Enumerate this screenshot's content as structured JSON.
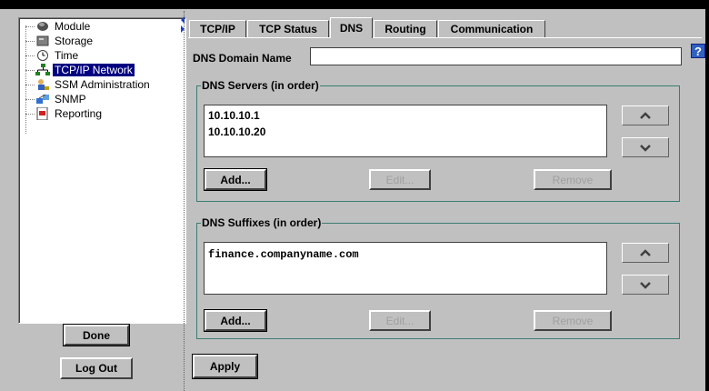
{
  "tree": {
    "items": [
      {
        "label": "Module",
        "icon": "module-icon"
      },
      {
        "label": "Storage",
        "icon": "storage-icon"
      },
      {
        "label": "Time",
        "icon": "clock-icon"
      },
      {
        "label": "TCP/IP Network",
        "icon": "network-icon",
        "selected": true
      },
      {
        "label": "SSM Administration",
        "icon": "admin-icon"
      },
      {
        "label": "SNMP",
        "icon": "snmp-icon"
      },
      {
        "label": "Reporting",
        "icon": "report-icon"
      }
    ]
  },
  "left_buttons": {
    "done": "Done",
    "logout": "Log Out"
  },
  "tabs": [
    {
      "label": "TCP/IP"
    },
    {
      "label": "TCP Status"
    },
    {
      "label": "DNS",
      "active": true
    },
    {
      "label": "Routing"
    },
    {
      "label": "Communication"
    }
  ],
  "help": {
    "label": "?"
  },
  "dns_domain": {
    "label": "DNS Domain Name",
    "value": ""
  },
  "dns_servers": {
    "title": "DNS Servers (in order)",
    "items": [
      "10.10.10.1",
      "10.10.10.20"
    ],
    "add": "Add...",
    "edit": "Edit...",
    "remove": "Remove"
  },
  "dns_suffixes": {
    "title": "DNS Suffixes (in order)",
    "items": [
      "finance.companyname.com"
    ],
    "add": "Add...",
    "edit": "Edit...",
    "remove": "Remove"
  },
  "apply": "Apply",
  "colors": {
    "selection": "#000080",
    "group_border": "#3b7d73",
    "help_bg": "#3060c0"
  }
}
